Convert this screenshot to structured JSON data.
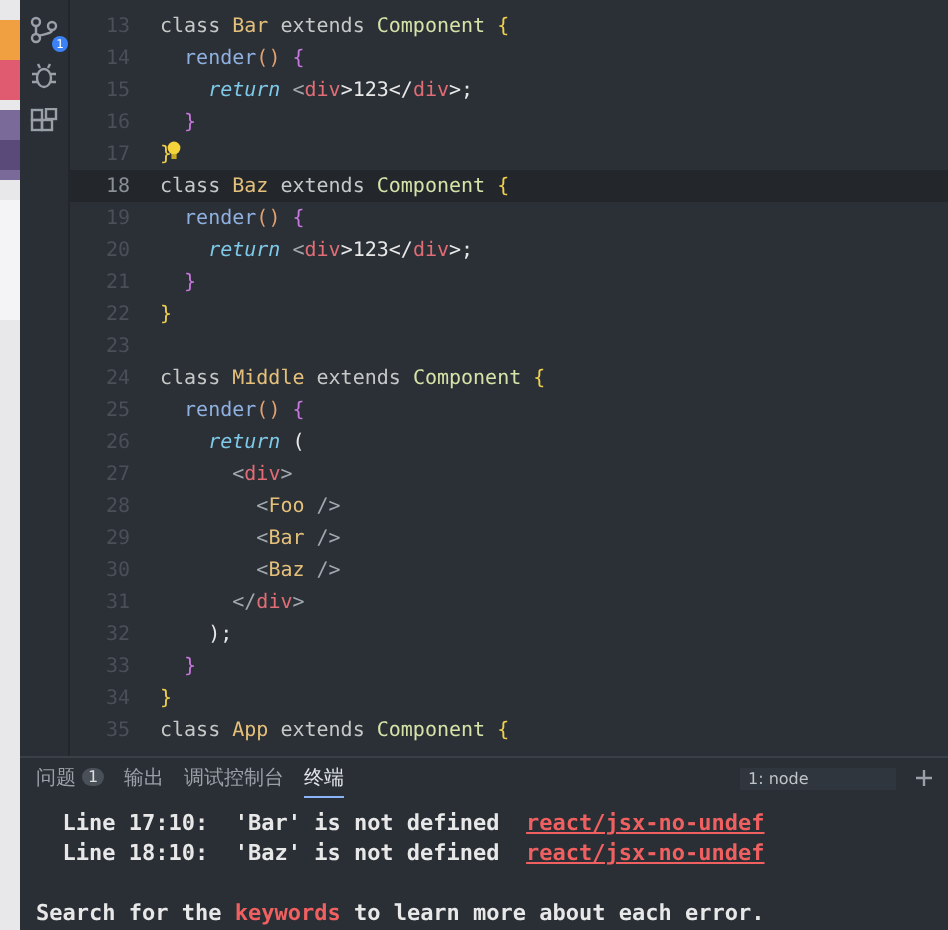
{
  "activity_bar": {
    "badge": "1"
  },
  "editor": {
    "lines": [
      {
        "number": "13",
        "current": false,
        "tokens": [
          {
            "text": "class ",
            "kind": "kw"
          },
          {
            "text": "Bar",
            "kind": "cls"
          },
          {
            "text": " extends ",
            "kind": "kw"
          },
          {
            "text": "Component ",
            "kind": "type"
          },
          {
            "text": "{",
            "kind": "brace"
          }
        ]
      },
      {
        "number": "14",
        "current": false,
        "tokens": [
          {
            "text": "  render",
            "kind": "fn"
          },
          {
            "text": "() ",
            "kind": "paren"
          },
          {
            "text": "{",
            "kind": "brace2"
          }
        ]
      },
      {
        "number": "15",
        "current": false,
        "tokens": [
          {
            "text": "    return ",
            "kind": "ret"
          },
          {
            "text": "<",
            "kind": "punct"
          },
          {
            "text": "div",
            "kind": "tag"
          },
          {
            "text": ">123</",
            "kind": "plain"
          },
          {
            "text": "div",
            "kind": "tag"
          },
          {
            "text": ">;",
            "kind": "plain"
          }
        ]
      },
      {
        "number": "16",
        "current": false,
        "tokens": [
          {
            "text": "  }",
            "kind": "brace2"
          }
        ]
      },
      {
        "number": "17",
        "current": false,
        "bulb": true,
        "tokens": [
          {
            "text": "}",
            "kind": "brace"
          }
        ]
      },
      {
        "number": "18",
        "current": true,
        "tokens": [
          {
            "text": "class ",
            "kind": "kw"
          },
          {
            "text": "Baz",
            "kind": "cls"
          },
          {
            "text": " extends ",
            "kind": "kw"
          },
          {
            "text": "Component ",
            "kind": "type"
          },
          {
            "text": "{",
            "kind": "brace"
          }
        ]
      },
      {
        "number": "19",
        "current": false,
        "tokens": [
          {
            "text": "  render",
            "kind": "fn"
          },
          {
            "text": "() ",
            "kind": "paren"
          },
          {
            "text": "{",
            "kind": "brace2"
          }
        ]
      },
      {
        "number": "20",
        "current": false,
        "tokens": [
          {
            "text": "    return ",
            "kind": "ret"
          },
          {
            "text": "<",
            "kind": "punct"
          },
          {
            "text": "div",
            "kind": "tag"
          },
          {
            "text": ">123</",
            "kind": "plain"
          },
          {
            "text": "div",
            "kind": "tag"
          },
          {
            "text": ">;",
            "kind": "plain"
          }
        ]
      },
      {
        "number": "21",
        "current": false,
        "tokens": [
          {
            "text": "  }",
            "kind": "brace2"
          }
        ]
      },
      {
        "number": "22",
        "current": false,
        "tokens": [
          {
            "text": "}",
            "kind": "brace"
          }
        ]
      },
      {
        "number": "23",
        "current": false
      },
      {
        "number": "24",
        "current": false,
        "tokens": [
          {
            "text": "class ",
            "kind": "kw"
          },
          {
            "text": "Middle",
            "kind": "cls"
          },
          {
            "text": " extends ",
            "kind": "kw"
          },
          {
            "text": "Component ",
            "kind": "type"
          },
          {
            "text": "{",
            "kind": "brace"
          }
        ]
      },
      {
        "number": "25",
        "current": false,
        "tokens": [
          {
            "text": "  render",
            "kind": "fn"
          },
          {
            "text": "() ",
            "kind": "paren"
          },
          {
            "text": "{",
            "kind": "brace2"
          }
        ]
      },
      {
        "number": "26",
        "current": false,
        "tokens": [
          {
            "text": "    return ",
            "kind": "ret"
          },
          {
            "text": "(",
            "kind": "plain"
          }
        ]
      },
      {
        "number": "27",
        "current": false,
        "tokens": [
          {
            "text": "      <",
            "kind": "punct"
          },
          {
            "text": "div",
            "kind": "tag"
          },
          {
            "text": ">",
            "kind": "punct"
          }
        ]
      },
      {
        "number": "28",
        "current": false,
        "tokens": [
          {
            "text": "        <",
            "kind": "punct"
          },
          {
            "text": "Foo",
            "kind": "cls"
          },
          {
            "text": " />",
            "kind": "punct"
          }
        ]
      },
      {
        "number": "29",
        "current": false,
        "tokens": [
          {
            "text": "        <",
            "kind": "punct"
          },
          {
            "text": "Bar",
            "kind": "cls"
          },
          {
            "text": " />",
            "kind": "punct"
          }
        ]
      },
      {
        "number": "30",
        "current": false,
        "tokens": [
          {
            "text": "        <",
            "kind": "punct"
          },
          {
            "text": "Baz",
            "kind": "cls"
          },
          {
            "text": " />",
            "kind": "punct"
          }
        ]
      },
      {
        "number": "31",
        "current": false,
        "tokens": [
          {
            "text": "      </",
            "kind": "punct"
          },
          {
            "text": "div",
            "kind": "tag"
          },
          {
            "text": ">",
            "kind": "punct"
          }
        ]
      },
      {
        "number": "32",
        "current": false,
        "tokens": [
          {
            "text": "    );",
            "kind": "plain"
          }
        ]
      },
      {
        "number": "33",
        "current": false,
        "tokens": [
          {
            "text": "  }",
            "kind": "brace2"
          }
        ]
      },
      {
        "number": "34",
        "current": false,
        "tokens": [
          {
            "text": "}",
            "kind": "brace"
          }
        ]
      },
      {
        "number": "35",
        "current": false,
        "tokens": [
          {
            "text": "class ",
            "kind": "kw"
          },
          {
            "text": "App",
            "kind": "cls"
          },
          {
            "text": " extends ",
            "kind": "kw"
          },
          {
            "text": "Component ",
            "kind": "type"
          },
          {
            "text": "{",
            "kind": "brace"
          }
        ]
      }
    ]
  },
  "panel": {
    "tabs": [
      {
        "label": "问题",
        "badge": "1",
        "selected": false
      },
      {
        "label": "输出",
        "selected": false
      },
      {
        "label": "调试控制台",
        "selected": false
      },
      {
        "label": "终端",
        "selected": true
      }
    ],
    "terminal_select": "1: node",
    "terminal_lines": [
      {
        "segments": [
          {
            "text": "  Line 17:10:  'Bar' is not defined  ",
            "kind": "text"
          },
          {
            "text": "react/jsx-no-undef",
            "kind": "link"
          }
        ]
      },
      {
        "segments": [
          {
            "text": "  Line 18:10:  'Baz' is not defined  ",
            "kind": "text"
          },
          {
            "text": "react/jsx-no-undef",
            "kind": "link"
          }
        ]
      },
      {
        "segments": [
          {
            "text": "Search for the ",
            "kind": "text"
          },
          {
            "text": "keywords",
            "kind": "hl"
          },
          {
            "text": " to learn more about each error.",
            "kind": "text"
          }
        ]
      }
    ]
  }
}
